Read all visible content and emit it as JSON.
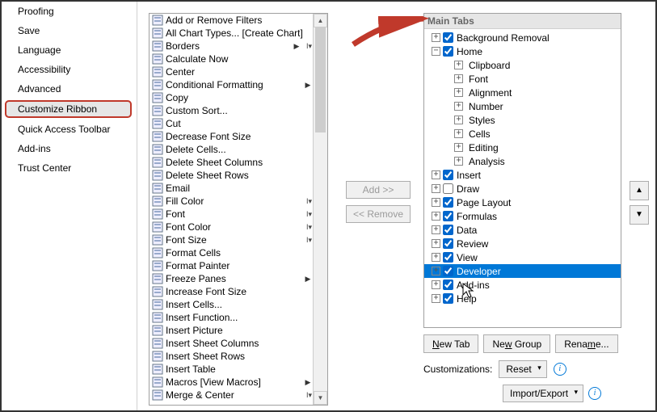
{
  "nav": {
    "items": [
      "Proofing",
      "Save",
      "Language",
      "Accessibility",
      "Advanced",
      "Customize Ribbon",
      "Quick Access Toolbar",
      "Add-ins",
      "Trust Center"
    ],
    "selected": "Customize Ribbon"
  },
  "commands": [
    {
      "label": "Add or Remove Filters"
    },
    {
      "label": "All Chart Types... [Create Chart]"
    },
    {
      "label": "Borders",
      "submenu": true,
      "combo": true
    },
    {
      "label": "Calculate Now"
    },
    {
      "label": "Center"
    },
    {
      "label": "Conditional Formatting",
      "submenu": true
    },
    {
      "label": "Copy"
    },
    {
      "label": "Custom Sort..."
    },
    {
      "label": "Cut"
    },
    {
      "label": "Decrease Font Size"
    },
    {
      "label": "Delete Cells..."
    },
    {
      "label": "Delete Sheet Columns"
    },
    {
      "label": "Delete Sheet Rows"
    },
    {
      "label": "Email"
    },
    {
      "label": "Fill Color",
      "combo": true
    },
    {
      "label": "Font",
      "combo": true
    },
    {
      "label": "Font Color",
      "combo": true
    },
    {
      "label": "Font Size",
      "combo": true
    },
    {
      "label": "Format Cells"
    },
    {
      "label": "Format Painter"
    },
    {
      "label": "Freeze Panes",
      "submenu": true
    },
    {
      "label": "Increase Font Size"
    },
    {
      "label": "Insert Cells..."
    },
    {
      "label": "Insert Function..."
    },
    {
      "label": "Insert Picture"
    },
    {
      "label": "Insert Sheet Columns"
    },
    {
      "label": "Insert Sheet Rows"
    },
    {
      "label": "Insert Table"
    },
    {
      "label": "Macros [View Macros]",
      "submenu": true
    },
    {
      "label": "Merge & Center",
      "combo": true
    }
  ],
  "tabs_header": "Main Tabs",
  "tree": [
    {
      "exp": "plus",
      "check": true,
      "indent": 0,
      "label": "Background Removal"
    },
    {
      "exp": "minus",
      "check": true,
      "indent": 0,
      "label": "Home"
    },
    {
      "exp": "plus",
      "indent": 1,
      "label": "Clipboard"
    },
    {
      "exp": "plus",
      "indent": 1,
      "label": "Font"
    },
    {
      "exp": "plus",
      "indent": 1,
      "label": "Alignment"
    },
    {
      "exp": "plus",
      "indent": 1,
      "label": "Number"
    },
    {
      "exp": "plus",
      "indent": 1,
      "label": "Styles"
    },
    {
      "exp": "plus",
      "indent": 1,
      "label": "Cells"
    },
    {
      "exp": "plus",
      "indent": 1,
      "label": "Editing"
    },
    {
      "exp": "plus",
      "indent": 1,
      "label": "Analysis"
    },
    {
      "exp": "plus",
      "check": true,
      "indent": 0,
      "label": "Insert"
    },
    {
      "exp": "plus",
      "check": false,
      "indent": 0,
      "label": "Draw"
    },
    {
      "exp": "plus",
      "check": true,
      "indent": 0,
      "label": "Page Layout"
    },
    {
      "exp": "plus",
      "check": true,
      "indent": 0,
      "label": "Formulas"
    },
    {
      "exp": "plus",
      "check": true,
      "indent": 0,
      "label": "Data"
    },
    {
      "exp": "plus",
      "check": true,
      "indent": 0,
      "label": "Review"
    },
    {
      "exp": "plus",
      "check": true,
      "indent": 0,
      "label": "View"
    },
    {
      "exp": "plus",
      "check": true,
      "indent": 0,
      "label": "Developer",
      "selected": true
    },
    {
      "exp": "plus",
      "check": true,
      "indent": 0,
      "label": "Add-ins"
    },
    {
      "exp": "plus",
      "check": true,
      "indent": 0,
      "label": "Help"
    }
  ],
  "buttons": {
    "add": "Add >>",
    "remove": "<< Remove",
    "new_tab": "New Tab",
    "new_group": "New Group",
    "rename": "Rename...",
    "customizations": "Customizations:",
    "reset": "Reset",
    "import_export": "Import/Export"
  }
}
